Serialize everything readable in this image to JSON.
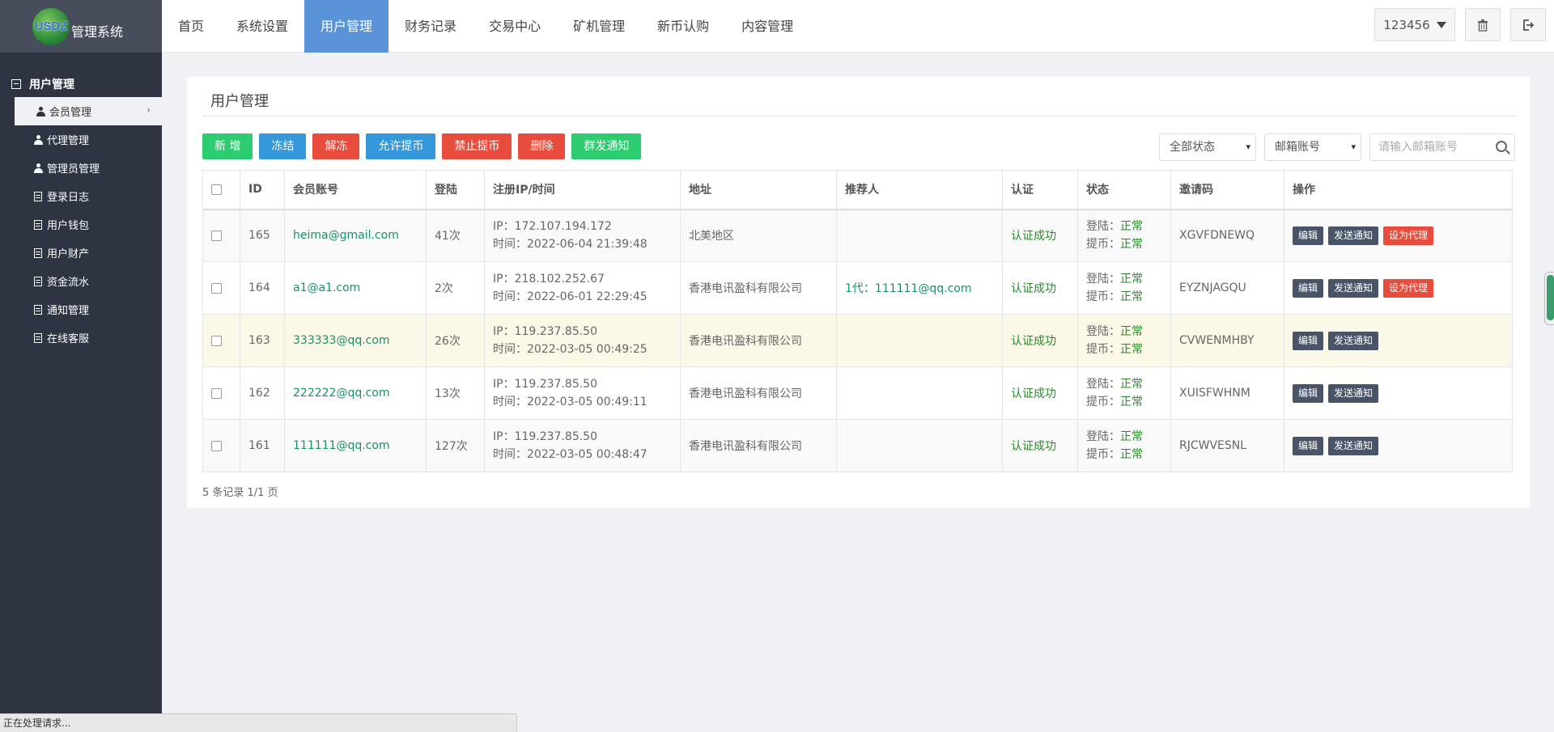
{
  "brand": {
    "logo_mark": "USDZ",
    "app_name": "管理系统"
  },
  "topnav": {
    "tabs": [
      "首页",
      "系统设置",
      "用户管理",
      "财务记录",
      "交易中心",
      "矿机管理",
      "新币认购",
      "内容管理"
    ],
    "active_tab": "用户管理",
    "user_label": "123456",
    "icons": [
      "trash-icon",
      "logout-icon"
    ]
  },
  "sidebar": {
    "group_title": "用户管理",
    "items": [
      {
        "label": "会员管理",
        "icon": "person-icon",
        "active": true
      },
      {
        "label": "代理管理",
        "icon": "person-icon"
      },
      {
        "label": "管理员管理",
        "icon": "person-icon"
      },
      {
        "label": "登录日志",
        "icon": "list-icon"
      },
      {
        "label": "用户钱包",
        "icon": "list-icon"
      },
      {
        "label": "用户财产",
        "icon": "list-icon"
      },
      {
        "label": "资金流水",
        "icon": "list-icon"
      },
      {
        "label": "通知管理",
        "icon": "list-icon"
      },
      {
        "label": "在线客服",
        "icon": "list-icon"
      }
    ]
  },
  "page": {
    "title": "用户管理",
    "buttons": {
      "add": "新 增",
      "freeze": "冻结",
      "unfreeze": "解冻",
      "allow_withdraw": "允许提币",
      "forbid_withdraw": "禁止提币",
      "delete": "删除",
      "broadcast": "群发通知"
    },
    "filters": {
      "status_select": "全部状态",
      "field_select": "邮箱账号",
      "search_placeholder": "请输入邮箱账号"
    },
    "table": {
      "headers": [
        "ID",
        "会员账号",
        "登陆",
        "注册IP/时间",
        "地址",
        "推荐人",
        "认证",
        "状态",
        "邀请码",
        "操作"
      ],
      "rows": [
        {
          "id": "165",
          "account": "heima@gmail.com",
          "logins": "41次",
          "ip": "IP：172.107.194.172",
          "time": "时间：2022-06-04 21:39:48",
          "address": "北美地区",
          "referrer": "",
          "auth": "认证成功",
          "login_label": "登陆：",
          "login_status": "正常",
          "withdraw_label": "提币：",
          "withdraw_status": "正常",
          "invite": "XGVFDNEWQ",
          "actions": [
            "编辑",
            "发送通知",
            "设为代理"
          ]
        },
        {
          "id": "164",
          "account": "a1@a1.com",
          "logins": "2次",
          "ip": "IP：218.102.252.67",
          "time": "时间：2022-06-01 22:29:45",
          "address": "香港电讯盈科有限公司",
          "referrer": "1代：111111@qq.com",
          "auth": "认证成功",
          "login_label": "登陆：",
          "login_status": "正常",
          "withdraw_label": "提币：",
          "withdraw_status": "正常",
          "invite": "EYZNJAGQU",
          "actions": [
            "编辑",
            "发送通知",
            "设为代理"
          ]
        },
        {
          "id": "163",
          "account": "333333@qq.com",
          "logins": "26次",
          "ip": "IP：119.237.85.50",
          "time": "时间：2022-03-05 00:49:25",
          "address": "香港电讯盈科有限公司",
          "referrer": "",
          "auth": "认证成功",
          "login_label": "登陆：",
          "login_status": "正常",
          "withdraw_label": "提币：",
          "withdraw_status": "正常",
          "invite": "CVWENMHBY",
          "actions": [
            "编辑",
            "发送通知"
          ]
        },
        {
          "id": "162",
          "account": "222222@qq.com",
          "logins": "13次",
          "ip": "IP：119.237.85.50",
          "time": "时间：2022-03-05 00:49:11",
          "address": "香港电讯盈科有限公司",
          "referrer": "",
          "auth": "认证成功",
          "login_label": "登陆：",
          "login_status": "正常",
          "withdraw_label": "提币：",
          "withdraw_status": "正常",
          "invite": "XUISFWHNM",
          "actions": [
            "编辑",
            "发送通知"
          ]
        },
        {
          "id": "161",
          "account": "111111@qq.com",
          "logins": "127次",
          "ip": "IP：119.237.85.50",
          "time": "时间：2022-03-05 00:48:47",
          "address": "香港电讯盈科有限公司",
          "referrer": "",
          "auth": "认证成功",
          "login_label": "登陆：",
          "login_status": "正常",
          "withdraw_label": "提币：",
          "withdraw_status": "正常",
          "invite": "RJCWVESNL",
          "actions": [
            "编辑",
            "发送通知"
          ]
        }
      ]
    },
    "records": "5 条记录 1/1 页"
  },
  "status_bar": "正在处理请求...",
  "colors": {
    "sidebar": "#2f3443",
    "active_tab": "#5a93d7",
    "green": "#2ecc71",
    "blue": "#3498db",
    "red": "#e74c3c",
    "link": "#1a8f6b"
  }
}
